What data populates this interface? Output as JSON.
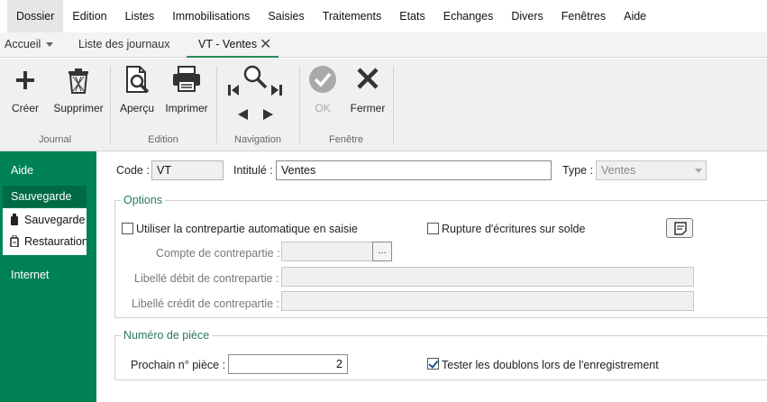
{
  "menu": [
    "Dossier",
    "Edition",
    "Listes",
    "Immobilisations",
    "Saisies",
    "Traitements",
    "Etats",
    "Echanges",
    "Divers",
    "Fenêtres",
    "Aide"
  ],
  "tabs": {
    "home": "Accueil",
    "journals": "Liste des journaux",
    "current": "VT - Ventes"
  },
  "ribbon": {
    "groups": {
      "journal": "Journal",
      "edition": "Edition",
      "navigation": "Navigation",
      "fenetre": "Fenêtre"
    },
    "buttons": {
      "create": "Créer",
      "delete": "Supprimer",
      "preview": "Aperçu",
      "print": "Imprimer",
      "ok": "OK",
      "close": "Fermer"
    }
  },
  "sidebar": {
    "help": "Aide",
    "backup_section": "Sauvegarde",
    "backup_items": [
      "Sauvegarde",
      "Restauration"
    ],
    "internet": "Internet"
  },
  "form": {
    "code_label": "Code :",
    "code_value": "VT",
    "title_label": "Intitulé :",
    "title_value": "Ventes",
    "type_label": "Type :",
    "type_value": "Ventes",
    "options_legend": "Options",
    "auto_counterpart_label": "Utiliser la contrepartie automatique en saisie",
    "auto_counterpart_checked": false,
    "break_entries_label": "Rupture d'écritures sur solde",
    "break_entries_checked": false,
    "counterpart_account_label": "Compte de contrepartie :",
    "counterpart_account_value": "",
    "ellipsis": "...",
    "debit_label_label": "Libellé débit de contrepartie :",
    "debit_label_value": "",
    "credit_label_label": "Libellé crédit de contrepartie :",
    "credit_label_value": "",
    "piece_legend": "Numéro de pièce",
    "next_piece_label": "Prochain n° pièce :",
    "next_piece_value": "2",
    "duplicates_label": "Tester les doublons lors de l'enregistrement",
    "duplicates_checked": true
  },
  "colors": {
    "accent": "#008255",
    "legend": "#2a7a55"
  }
}
